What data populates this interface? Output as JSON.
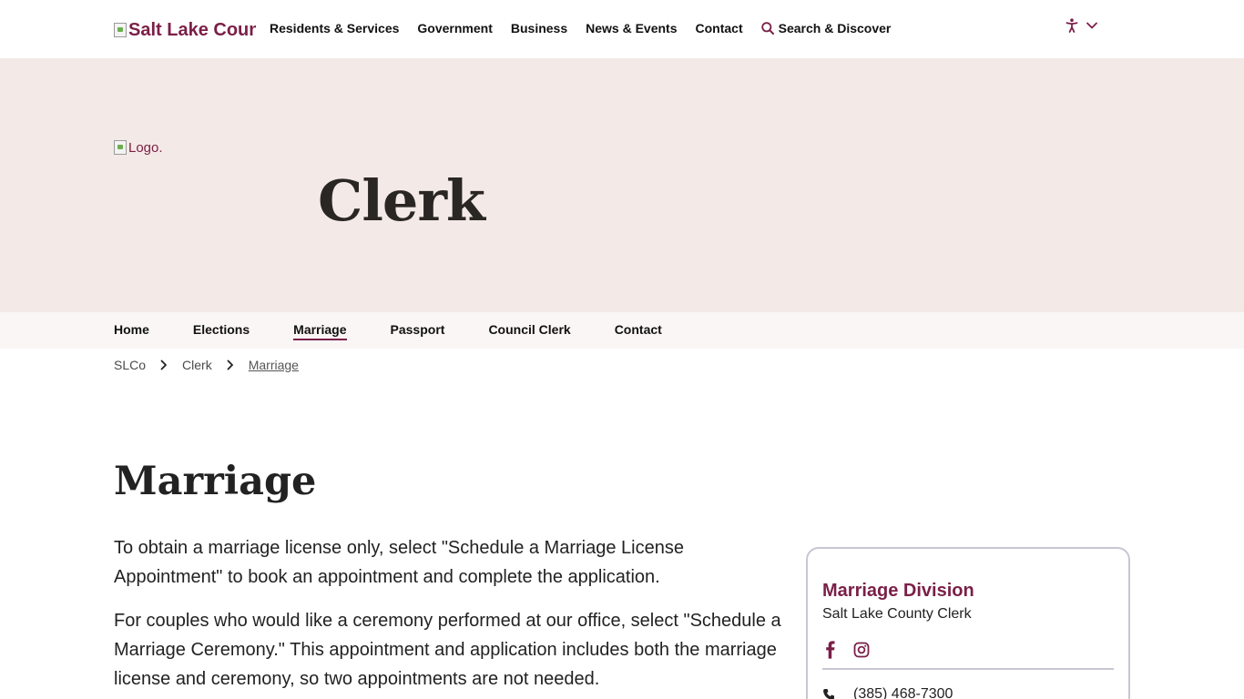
{
  "header": {
    "logo_alt": "Salt Lake County",
    "nav_items": [
      "Residents & Services",
      "Government",
      "Business",
      "News & Events",
      "Contact"
    ],
    "search_label": "Search & Discover",
    "search_icon": "search-icon",
    "accessibility_icon": "accessibility-icon",
    "accessibility_chevron": "chevron-down-icon"
  },
  "hero": {
    "logo_alt": "Logo.",
    "title": "Clerk",
    "background_color": "#f3e9e6"
  },
  "sub_nav": {
    "items": [
      "Home",
      "Elections",
      "Marriage",
      "Passport",
      "Council Clerk",
      "Contact"
    ],
    "active": "Marriage"
  },
  "breadcrumb": {
    "items": [
      "SLCo",
      "Clerk",
      "Marriage"
    ],
    "separator_icon": "chevron-right-icon"
  },
  "main": {
    "title": "Marriage",
    "paragraphs": [
      "To obtain a marriage license only, select \"Schedule a Marriage License Appointment\" to book an appointment and complete the application.",
      "For couples who would like a ceremony performed at our office, select \"Schedule a Marriage Ceremony.\" This appointment and application includes both the marriage license and ceremony, so two appointments are not needed."
    ]
  },
  "sidebar": {
    "title": "Marriage Division",
    "subtitle": "Salt Lake County Clerk",
    "social_icons": [
      "facebook-icon",
      "instagram-icon"
    ],
    "phone_icon": "phone-icon",
    "phone": "(385) 468-7300"
  },
  "colors": {
    "brand": "#7a1f47",
    "hero_bg": "#f3e9e6",
    "subnav_bg": "#faf6f5",
    "card_border": "#c9c5d3"
  }
}
